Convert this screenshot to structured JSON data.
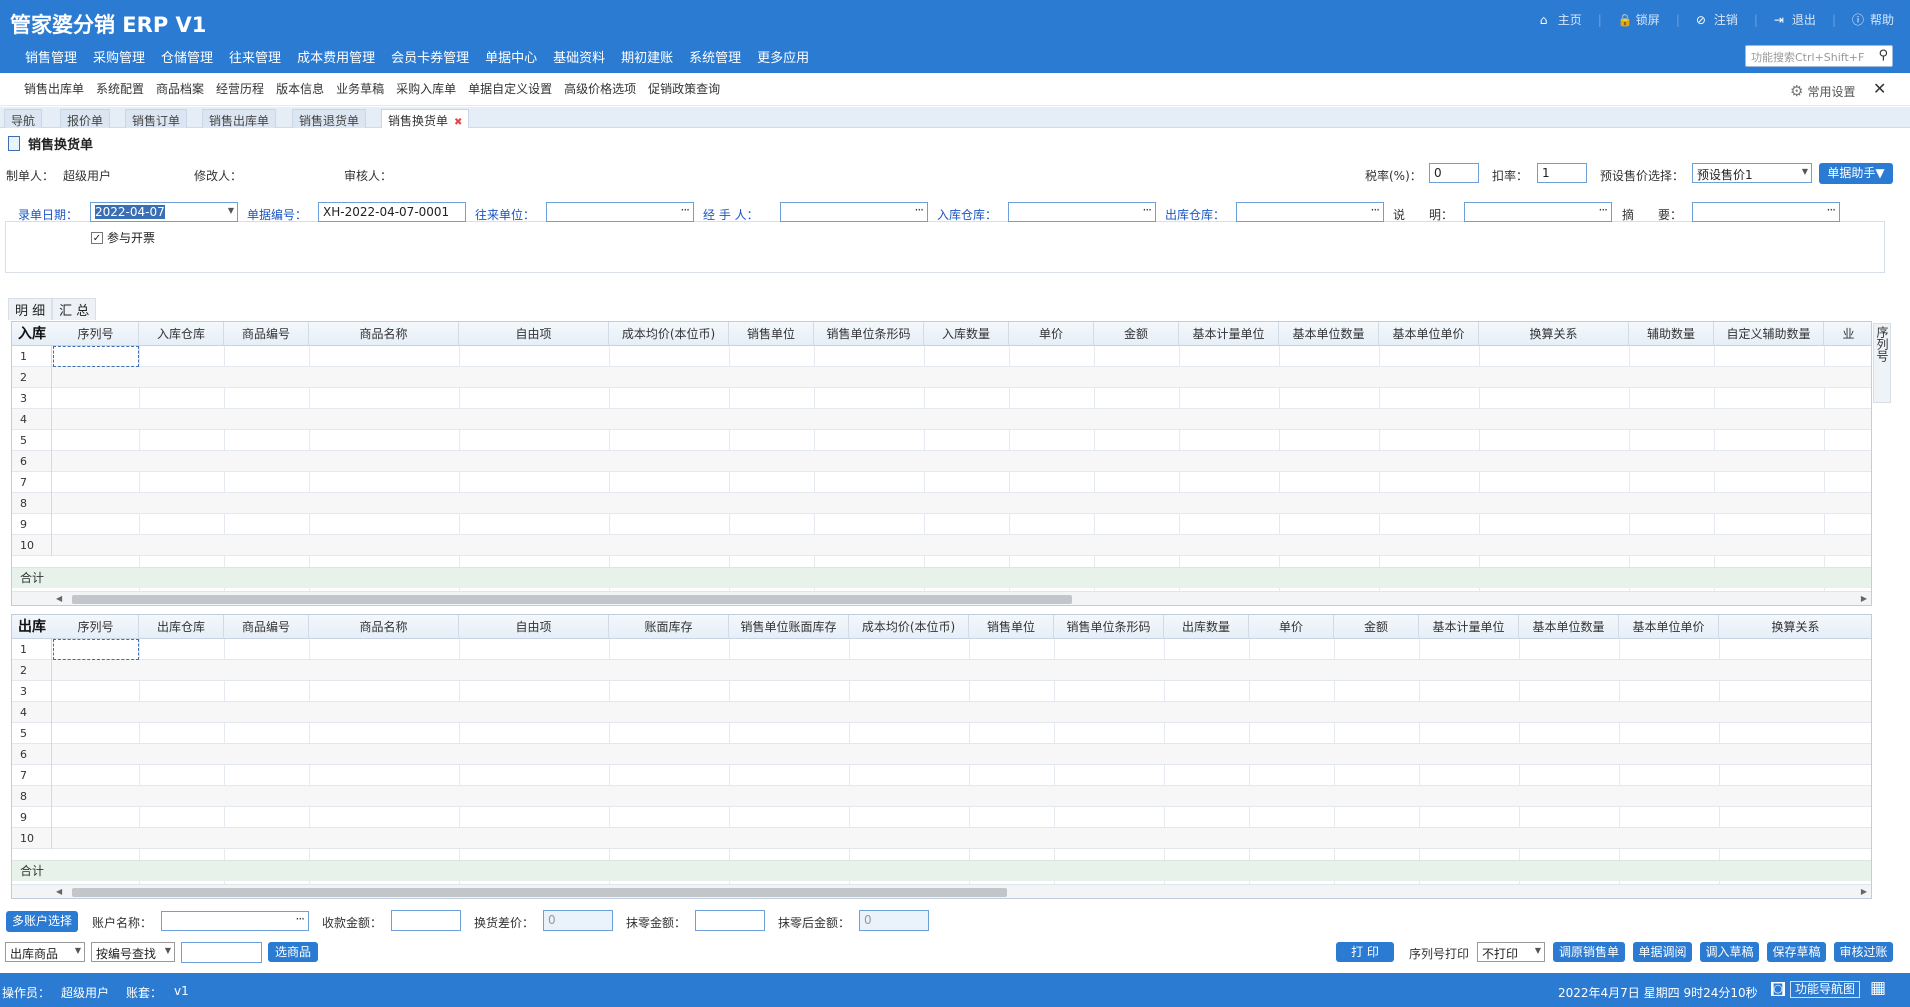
{
  "app": {
    "title": "管家婆分销 ERP V1"
  },
  "toplinks": {
    "home": "主页",
    "lock": "锁屏",
    "logout": "注销",
    "exit": "退出",
    "help": "帮助"
  },
  "mainnav": [
    "销售管理",
    "采购管理",
    "仓储管理",
    "往来管理",
    "成本费用管理",
    "会员卡券管理",
    "单据中心",
    "基础资料",
    "期初建账",
    "系统管理",
    "更多应用"
  ],
  "search": {
    "placeholder": "功能搜索Ctrl+Shift+F"
  },
  "subnav": {
    "items": [
      "销售出库单",
      "系统配置",
      "商品档案",
      "经营历程",
      "版本信息",
      "业务草稿",
      "采购入库单",
      "单据自定义设置",
      "高级价格选项",
      "促销政策查询"
    ],
    "settings": "常用设置"
  },
  "tabs": [
    "导航",
    "报价单",
    "销售订单",
    "销售出库单",
    "销售退货单",
    "销售换货单"
  ],
  "doc": {
    "title": "销售换货单"
  },
  "meta": {
    "creator_label": "制单人：",
    "creator": "超级用户",
    "modifier_label": "修改人：",
    "reviewer_label": "审核人：",
    "tax_label": "税率(%)：",
    "tax_value": "0",
    "discount_label": "扣率：",
    "discount_value": "1",
    "price_label": "预设售价选择：",
    "price_value": "预设售价1",
    "helper_button": "单据助手▼"
  },
  "filters": {
    "date_label": "录单日期：",
    "date_value": "2022-04-07",
    "number_label": "单据编号：",
    "number_value": "XH-2022-04-07-0001",
    "partner_label": "往来单位：",
    "handler_label": "经 手 人：",
    "in_wh_label": "入库仓库：",
    "out_wh_label": "出库仓库：",
    "note_label": "说　　明：",
    "summary_label": "摘　　要：",
    "invoice_label": "参与开票"
  },
  "detail_tabs": [
    "明 细",
    "汇 总"
  ],
  "in_grid": {
    "corner": "入库",
    "headers": [
      "序列号",
      "入库仓库",
      "商品编号",
      "商品名称",
      "自由项",
      "成本均价(本位币)",
      "销售单位",
      "销售单位条形码",
      "入库数量",
      "单价",
      "金额",
      "基本计量单位",
      "基本单位数量",
      "基本单位单价",
      "换算关系",
      "辅助数量",
      "自定义辅助数量",
      "业"
    ],
    "rows": [
      "1",
      "2",
      "3",
      "4",
      "5",
      "6",
      "7",
      "8",
      "9",
      "10"
    ],
    "sum": "合计"
  },
  "out_grid": {
    "corner": "出库",
    "headers": [
      "序列号",
      "出库仓库",
      "商品编号",
      "商品名称",
      "自由项",
      "账面库存",
      "销售单位账面库存",
      "成本均价(本位币)",
      "销售单位",
      "销售单位条形码",
      "出库数量",
      "单价",
      "金额",
      "基本计量单位",
      "基本单位数量",
      "基本单位单价",
      "换算关系"
    ],
    "rows": [
      "1",
      "2",
      "3",
      "4",
      "5",
      "6",
      "7",
      "8",
      "9",
      "10"
    ],
    "sum": "合计"
  },
  "side": {
    "serial": "序列号"
  },
  "bottom": {
    "multi_account": "多账户选择",
    "account_label": "账户名称：",
    "received_label": "收款金额：",
    "diff_label": "换货差价：",
    "diff_value": "0",
    "round_label": "抹零金额：",
    "after_round_label": "抹零后金额：",
    "after_round_value": "0",
    "goods_select": "出库商品",
    "search_mode": "按编号查找",
    "pick_button": "选商品",
    "print_button": "打 印",
    "serial_print_label": "序列号打印",
    "serial_print_value": "不打印",
    "buttons": [
      "调原销售单",
      "单据调阅",
      "调入草稿",
      "保存草稿",
      "审核过账"
    ]
  },
  "footer": {
    "operator_label": "操作员：",
    "operator": "超级用户",
    "account_label": "账套：",
    "account": "v1",
    "datetime": "2022年4月7日 星期四 9时24分10秒",
    "nav_map": "功能导航图"
  }
}
